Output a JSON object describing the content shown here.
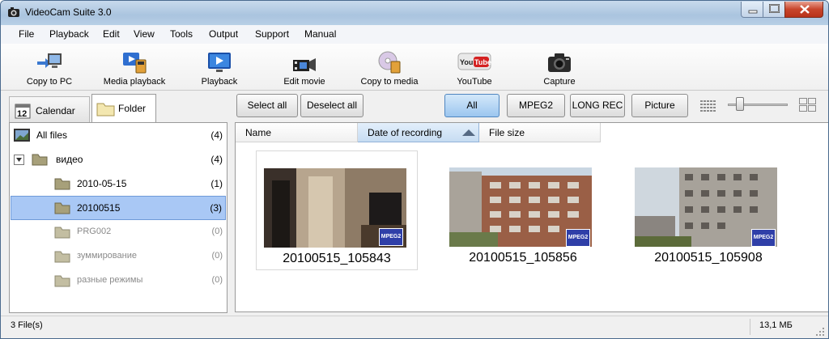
{
  "window": {
    "title": "VideoCam Suite 3.0"
  },
  "menu": [
    "File",
    "Playback",
    "Edit",
    "View",
    "Tools",
    "Output",
    "Support",
    "Manual"
  ],
  "toolbar": [
    {
      "label": "Copy to PC",
      "icon": "copy-to-pc-icon"
    },
    {
      "label": "Media playback",
      "icon": "media-playback-icon"
    },
    {
      "label": "Playback",
      "icon": "playback-icon"
    },
    {
      "label": "Edit movie",
      "icon": "edit-movie-icon"
    },
    {
      "label": "Copy to media",
      "icon": "copy-to-media-icon"
    },
    {
      "label": "YouTube",
      "icon": "youtube-icon"
    },
    {
      "label": "Capture",
      "icon": "camera-icon"
    }
  ],
  "youtube_logo_text": "YouTube",
  "tabs": {
    "calendar": "Calendar",
    "calendar_day": "12",
    "folder": "Folder"
  },
  "tree": [
    {
      "name": "All files",
      "count": "(4)"
    },
    {
      "name": "видео",
      "count": "(4)"
    },
    {
      "name": "2010-05-15",
      "count": "(1)"
    },
    {
      "name": "20100515",
      "count": "(3)"
    },
    {
      "name": "PRG002",
      "count": "(0)"
    },
    {
      "name": "зуммирование",
      "count": "(0)"
    },
    {
      "name": "разные режимы",
      "count": "(0)"
    }
  ],
  "buttons": {
    "select_all": "Select all",
    "deselect_all": "Deselect all",
    "all": "All",
    "mpeg2": "MPEG2",
    "long_rec": "LONG REC",
    "picture": "Picture"
  },
  "zoom_slider_level": 0.15,
  "columns": {
    "name": "Name",
    "date": "Date of recording",
    "size": "File size"
  },
  "thumbnails": [
    {
      "caption": "20100515_105843",
      "badge": "MPEG2"
    },
    {
      "caption": "20100515_105856",
      "badge": "MPEG2"
    },
    {
      "caption": "20100515_105908",
      "badge": "MPEG2"
    }
  ],
  "status": {
    "files": "3 File(s)",
    "size": "13,1 МБ"
  },
  "colors": {
    "selection": "#a9c8f5",
    "pressed_button": "#9cc6ef",
    "close_button": "#c8452b",
    "badge": "#2f3fa8"
  }
}
